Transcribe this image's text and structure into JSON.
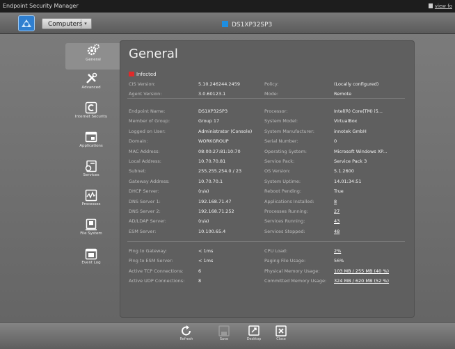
{
  "titlebar": {
    "title": "Endpoint Security Manager",
    "view_link": "view fo"
  },
  "toolbar": {
    "computers_label": "Computers",
    "device_name": "DS1XP32SP3",
    "colors": {
      "device_square": "#1e8ee0",
      "logo": "#2f7fd0"
    }
  },
  "sidebar": {
    "items": [
      {
        "label": "General",
        "icon": "gear-icon",
        "active": true
      },
      {
        "label": "Advanced",
        "icon": "tools-icon"
      },
      {
        "label": "Internet Security",
        "icon": "internet-security-icon"
      },
      {
        "label": "Applications",
        "icon": "applications-icon"
      },
      {
        "label": "Services",
        "icon": "services-icon"
      },
      {
        "label": "Processes",
        "icon": "processes-icon"
      },
      {
        "label": "File System",
        "icon": "file-system-icon"
      },
      {
        "label": "Event Log",
        "icon": "event-log-icon"
      }
    ]
  },
  "panel": {
    "title": "General",
    "status": {
      "label": "Infected",
      "color": "#e02a2a"
    },
    "group1": {
      "left": [
        {
          "label": "CIS Version:",
          "value": "5.10.246244.2459"
        },
        {
          "label": "Agent Version:",
          "value": "3.0.60123.1"
        }
      ],
      "right": [
        {
          "label": "Policy:",
          "value": "(Locally configured)"
        },
        {
          "label": "Mode:",
          "value": "Remote"
        }
      ]
    },
    "group2": {
      "left": [
        {
          "label": "Endpoint Name:",
          "value": "DS1XP32SP3"
        },
        {
          "label": "Member of Group:",
          "value": "Group 17"
        },
        {
          "label": "Logged on User:",
          "value": "Administrator (Console)"
        },
        {
          "label": "Domain:",
          "value": "WORKGROUP"
        },
        {
          "label": "MAC Address:",
          "value": "08:00:27:81:10:70"
        },
        {
          "label": "Local Address:",
          "value": "10.70.70.81"
        },
        {
          "label": "Subnet:",
          "value": "255.255.254.0 / 23"
        },
        {
          "label": "Gateway Address:",
          "value": "10.70.70.1"
        },
        {
          "label": "DHCP Server:",
          "value": "(n/a)"
        },
        {
          "label": "DNS Server 1:",
          "value": "192.168.71.47"
        },
        {
          "label": "DNS Server 2:",
          "value": "192.168.71.252"
        },
        {
          "label": "AD/LDAP Server:",
          "value": "(n/a)"
        },
        {
          "label": "ESM Server:",
          "value": "10.100.65.4"
        }
      ],
      "right": [
        {
          "label": "Processor:",
          "value": "Intel(R) Core(TM) i5..."
        },
        {
          "label": "System Model:",
          "value": "VirtualBox"
        },
        {
          "label": "System Manufacturer:",
          "value": "innotek GmbH"
        },
        {
          "label": "Serial Number:",
          "value": "0"
        },
        {
          "label": "Operating System:",
          "value": "Microsoft Windows XP..."
        },
        {
          "label": "Service Pack:",
          "value": "Service Pack 3"
        },
        {
          "label": "OS Version:",
          "value": "5.1.2600"
        },
        {
          "label": "System Uptime:",
          "value": "14.01:34:51"
        },
        {
          "label": "Reboot Pending:",
          "value": "True"
        },
        {
          "label": "Applications Installed:",
          "value": "8",
          "link": true
        },
        {
          "label": "Processes Running:",
          "value": "27",
          "link": true
        },
        {
          "label": "Services Running:",
          "value": "43",
          "link": true
        },
        {
          "label": "Services Stopped:",
          "value": "48",
          "link": true
        }
      ]
    },
    "group3": {
      "left": [
        {
          "label": "Ping to Gateway:",
          "value": "< 1ms"
        },
        {
          "label": "Ping to ESM Server:",
          "value": "< 1ms"
        },
        {
          "label": "Active TCP Connections:",
          "value": "6"
        },
        {
          "label": "Active UDP Connections:",
          "value": "8"
        }
      ],
      "right": [
        {
          "label": "CPU Load:",
          "value": "2%",
          "link": true
        },
        {
          "label": "Paging File Usage:",
          "value": "56%"
        },
        {
          "label": "Physical Memory Usage:",
          "value": "103 MB / 255 MB (40 %)",
          "link": true
        },
        {
          "label": "Committed Memory Usage:",
          "value": "324 MB / 620 MB (52 %)",
          "link": true
        }
      ]
    }
  },
  "bottombar": {
    "buttons": [
      {
        "label": "Refresh",
        "icon": "refresh-icon"
      },
      {
        "label": "Save",
        "icon": "save-icon"
      },
      {
        "label": "Desktop",
        "icon": "desktop-icon"
      },
      {
        "label": "Close",
        "icon": "close-icon"
      }
    ]
  }
}
